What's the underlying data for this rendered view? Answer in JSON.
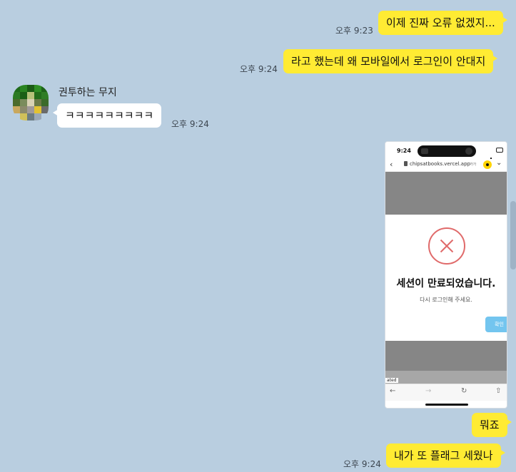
{
  "messages": {
    "m1": {
      "text": "이제 진짜 오류 없겠지...",
      "time": "오후 9:23"
    },
    "m2": {
      "text": "라고 했는데 왜 모바일에서 로그인이 안대지",
      "time": "오후 9:24"
    },
    "m3": {
      "sender": "권투하는 무지",
      "text": "ㅋㅋㅋㅋㅋㅋㅋㅋㅋ",
      "time": "오후 9:24"
    },
    "m5": {
      "text": "뭐죠"
    },
    "m6": {
      "text": "내가 또 플래그 세웠나",
      "time": "오후 9:24"
    }
  },
  "screenshot": {
    "clock": "9:24",
    "url": "chipsatbooks.vercel.app",
    "aa": "가가",
    "modal_title": "세션이 만료되었습니다.",
    "modal_sub": "다시 로그인해 주세요.",
    "confirm": "확인",
    "partial_text": "ated",
    "icons": [
      "back-icon",
      "lock-icon",
      "x-circle-icon",
      "forward-icon",
      "reload-icon",
      "share-icon"
    ]
  },
  "colors": {
    "background": "#b9cee0",
    "my_bubble": "#ffeb33",
    "their_bubble": "#ffffff",
    "error_red": "#e06a6a",
    "confirm_blue": "#73c5ef"
  }
}
